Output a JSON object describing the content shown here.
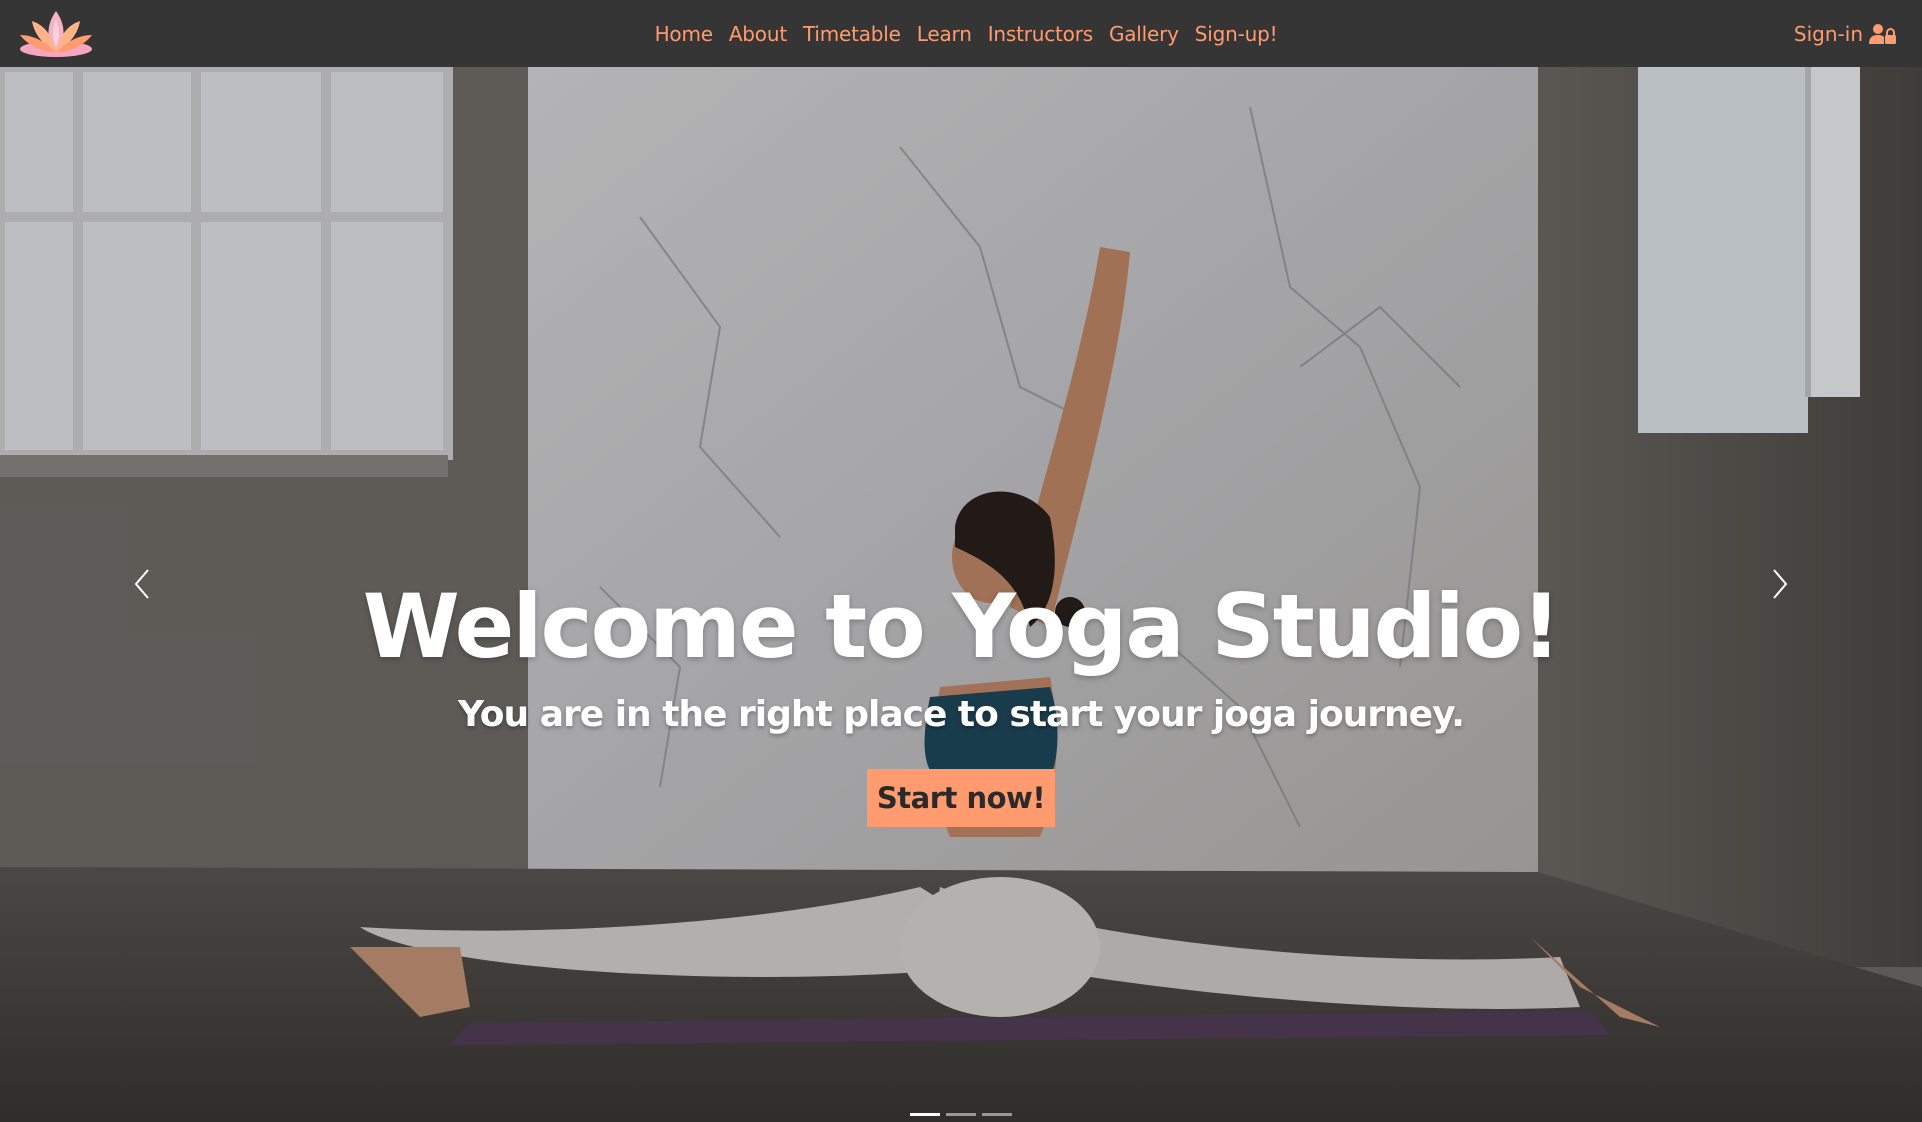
{
  "brand": {
    "logo_icon": "lotus-icon",
    "accent_color": "#ff9b6e",
    "nav_bg": "#353535"
  },
  "nav": {
    "items": [
      {
        "label": "Home"
      },
      {
        "label": "About"
      },
      {
        "label": "Timetable"
      },
      {
        "label": "Learn"
      },
      {
        "label": "Instructors"
      },
      {
        "label": "Gallery"
      },
      {
        "label": "Sign-up!"
      }
    ],
    "signin": {
      "label": "Sign-in",
      "icon": "user-lock-icon"
    }
  },
  "hero": {
    "headline": "Welcome to Yoga Studio!",
    "subheadline": "You are in the right place to start your joga journey.",
    "cta_label": "Start now!",
    "prev_icon": "chevron-left-icon",
    "next_icon": "chevron-right-icon",
    "slides_count": 3,
    "active_slide": 1
  }
}
